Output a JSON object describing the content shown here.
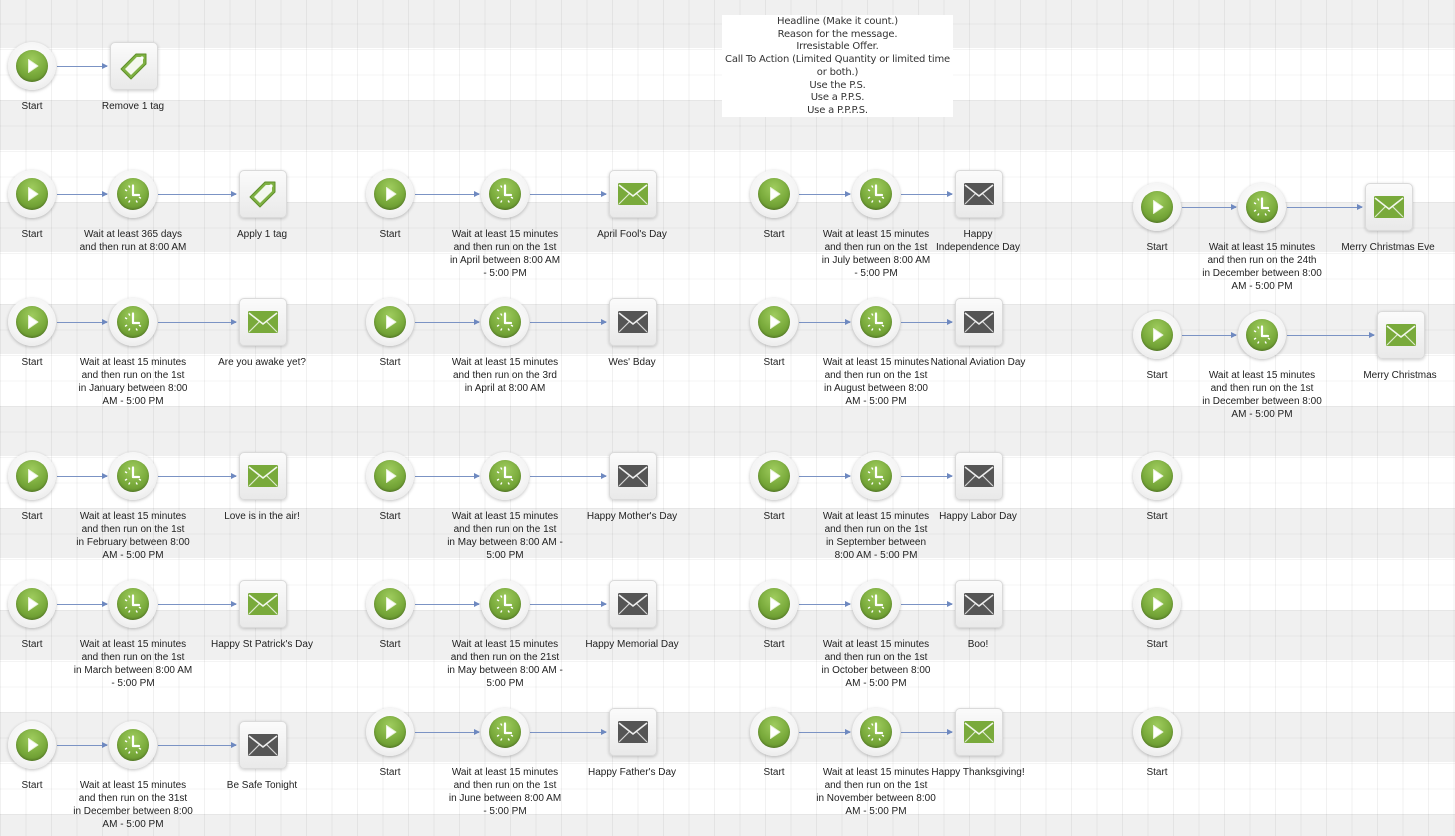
{
  "note": {
    "lines": "Headline (Make it count.)\nReason for the message.\nIrresistable Offer.\nCall To Action (Limited Quantity or limited time or both.)\nUse the P.S.\nUse a P.P.S.\nUse a P.P.P.S."
  },
  "colors": {
    "active_email": "#79aa3b",
    "inactive_email": "#555555",
    "connector": "#7b93c4",
    "band_gray": "#f0f0f0"
  },
  "sequences": [
    {
      "id": "remove-tag",
      "nodes": [
        {
          "type": "start",
          "label": "Start"
        },
        {
          "type": "tag",
          "label": "Remove 1 tag",
          "icon": "tag-icon"
        }
      ]
    },
    {
      "id": "anniversary",
      "nodes": [
        {
          "type": "start",
          "label": "Start"
        },
        {
          "type": "timer",
          "label": "Wait at least 365 days\nand then run at 8:00 AM"
        },
        {
          "type": "tag",
          "label": "Apply 1 tag",
          "icon": "tag-icon"
        }
      ]
    },
    {
      "id": "april-fools",
      "nodes": [
        {
          "type": "start",
          "label": "Start"
        },
        {
          "type": "timer",
          "label": "Wait at least 15 minutes\nand then run on the 1st\nin April between 8:00 AM\n- 5:00 PM"
        },
        {
          "type": "email",
          "label": "April Fool's Day",
          "status": "active"
        }
      ]
    },
    {
      "id": "independence",
      "nodes": [
        {
          "type": "start",
          "label": "Start"
        },
        {
          "type": "timer",
          "label": "Wait at least 15 minutes\nand then run on the 1st\nin July between 8:00 AM\n- 5:00 PM"
        },
        {
          "type": "email",
          "label": "Happy\nIndependence Day",
          "status": "inactive"
        }
      ]
    },
    {
      "id": "christmas-eve",
      "nodes": [
        {
          "type": "start",
          "label": "Start"
        },
        {
          "type": "timer",
          "label": "Wait at least 15 minutes\nand then run on the 24th\nin December between 8:00\nAM - 5:00 PM"
        },
        {
          "type": "email",
          "label": "Merry Christmas Eve",
          "status": "active"
        }
      ]
    },
    {
      "id": "new-year",
      "nodes": [
        {
          "type": "start",
          "label": "Start"
        },
        {
          "type": "timer",
          "label": "Wait at least 15 minutes\nand then run on the 1st\nin January between 8:00\nAM - 5:00 PM"
        },
        {
          "type": "email",
          "label": "Are you awake yet?",
          "status": "active"
        }
      ]
    },
    {
      "id": "wes-bday",
      "nodes": [
        {
          "type": "start",
          "label": "Start"
        },
        {
          "type": "timer",
          "label": "Wait at least 15 minutes\nand then run on the 3rd\nin April at 8:00 AM"
        },
        {
          "type": "email",
          "label": "Wes' Bday",
          "status": "inactive"
        }
      ]
    },
    {
      "id": "aviation",
      "nodes": [
        {
          "type": "start",
          "label": "Start"
        },
        {
          "type": "timer",
          "label": "Wait at least 15 minutes\nand then run on the 1st\nin August between 8:00\nAM - 5:00 PM"
        },
        {
          "type": "email",
          "label": "National Aviation Day",
          "status": "inactive"
        }
      ]
    },
    {
      "id": "christmas",
      "nodes": [
        {
          "type": "start",
          "label": "Start"
        },
        {
          "type": "timer",
          "label": "Wait at least 15 minutes\nand then run on the 1st\nin December between 8:00\nAM - 5:00 PM"
        },
        {
          "type": "email",
          "label": "Merry Christmas",
          "status": "active"
        }
      ]
    },
    {
      "id": "valentines",
      "nodes": [
        {
          "type": "start",
          "label": "Start"
        },
        {
          "type": "timer",
          "label": "Wait at least 15 minutes\nand then run on the 1st\nin February between 8:00\nAM - 5:00 PM"
        },
        {
          "type": "email",
          "label": "Love is in the air!",
          "status": "active"
        }
      ]
    },
    {
      "id": "mothers-day",
      "nodes": [
        {
          "type": "start",
          "label": "Start"
        },
        {
          "type": "timer",
          "label": "Wait at least 15 minutes\nand then run on the 1st\nin May between 8:00 AM -\n5:00 PM"
        },
        {
          "type": "email",
          "label": "Happy Mother's Day",
          "status": "inactive"
        }
      ]
    },
    {
      "id": "labor-day",
      "nodes": [
        {
          "type": "start",
          "label": "Start"
        },
        {
          "type": "timer",
          "label": "Wait at least 15 minutes\nand then run on the 1st\nin September between\n8:00 AM - 5:00 PM"
        },
        {
          "type": "email",
          "label": "Happy Labor Day",
          "status": "inactive"
        }
      ]
    },
    {
      "id": "empty-1",
      "nodes": [
        {
          "type": "start",
          "label": "Start"
        }
      ]
    },
    {
      "id": "st-patricks",
      "nodes": [
        {
          "type": "start",
          "label": "Start"
        },
        {
          "type": "timer",
          "label": "Wait at least 15 minutes\nand then run on the 1st\nin March between 8:00 AM\n- 5:00 PM"
        },
        {
          "type": "email",
          "label": "Happy St Patrick's Day",
          "status": "active"
        }
      ]
    },
    {
      "id": "memorial-day",
      "nodes": [
        {
          "type": "start",
          "label": "Start"
        },
        {
          "type": "timer",
          "label": "Wait at least 15 minutes\nand then run on the 21st\nin May between 8:00 AM -\n5:00 PM"
        },
        {
          "type": "email",
          "label": "Happy Memorial Day",
          "status": "inactive"
        }
      ]
    },
    {
      "id": "halloween",
      "nodes": [
        {
          "type": "start",
          "label": "Start"
        },
        {
          "type": "timer",
          "label": "Wait at least 15 minutes\nand then run on the 1st\nin October between 8:00\nAM - 5:00 PM"
        },
        {
          "type": "email",
          "label": "Boo!",
          "status": "inactive"
        }
      ]
    },
    {
      "id": "empty-2",
      "nodes": [
        {
          "type": "start",
          "label": "Start"
        }
      ]
    },
    {
      "id": "new-years-eve",
      "nodes": [
        {
          "type": "start",
          "label": "Start"
        },
        {
          "type": "timer",
          "label": "Wait at least 15 minutes\nand then run on the 31st\nin December between 8:00\nAM - 5:00 PM"
        },
        {
          "type": "email",
          "label": "Be Safe Tonight",
          "status": "inactive"
        }
      ]
    },
    {
      "id": "fathers-day",
      "nodes": [
        {
          "type": "start",
          "label": "Start"
        },
        {
          "type": "timer",
          "label": "Wait at least 15 minutes\nand then run on the 1st\nin June between 8:00 AM\n- 5:00 PM"
        },
        {
          "type": "email",
          "label": "Happy Father's Day",
          "status": "inactive"
        }
      ]
    },
    {
      "id": "thanksgiving",
      "nodes": [
        {
          "type": "start",
          "label": "Start"
        },
        {
          "type": "timer",
          "label": "Wait at least 15 minutes\nand then run on the 1st\nin November between 8:00\nAM - 5:00 PM"
        },
        {
          "type": "email",
          "label": "Happy Thanksgiving!",
          "status": "active"
        }
      ]
    },
    {
      "id": "empty-3",
      "nodes": [
        {
          "type": "start",
          "label": "Start"
        }
      ]
    }
  ]
}
